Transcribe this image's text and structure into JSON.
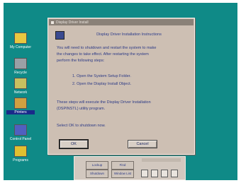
{
  "desktop": {
    "icons": [
      {
        "label": "My Computer",
        "color": "#e8c840"
      },
      {
        "label": "Recycle",
        "color": "#9aa0a6"
      },
      {
        "label": "Network",
        "color": "#c8c060"
      },
      {
        "label": "Printers",
        "color": "#d0a040"
      },
      {
        "label": "Control Panel",
        "color": "#5060c0"
      },
      {
        "label": "Programs",
        "color": "#e0c030"
      }
    ]
  },
  "dialog": {
    "title": "Display Driver Install",
    "heading": "Display Driver Installation Instructions",
    "intro_lines": [
      "You will need to shutdown and restart the system to make",
      "the changes to take effect. After restarting the system",
      "perform the following steps:"
    ],
    "steps": [
      "1. Open the System Setup Folder.",
      "2. Open the Display Install Object."
    ],
    "note_lines": [
      "These steps will execute the Display Driver Installation",
      "(DSPINSTL) utility program."
    ],
    "prompt": "Select OK to shutdown now.",
    "ok_label": "OK",
    "cancel_label": "Cancel"
  },
  "control_strip": {
    "buttons": [
      "Lockup",
      "Find",
      "Shutdown",
      "Window List"
    ]
  },
  "colors": {
    "desktop": "#0f8a87",
    "dialog_bg": "#cdbfb3",
    "text": "#2c3a86"
  }
}
